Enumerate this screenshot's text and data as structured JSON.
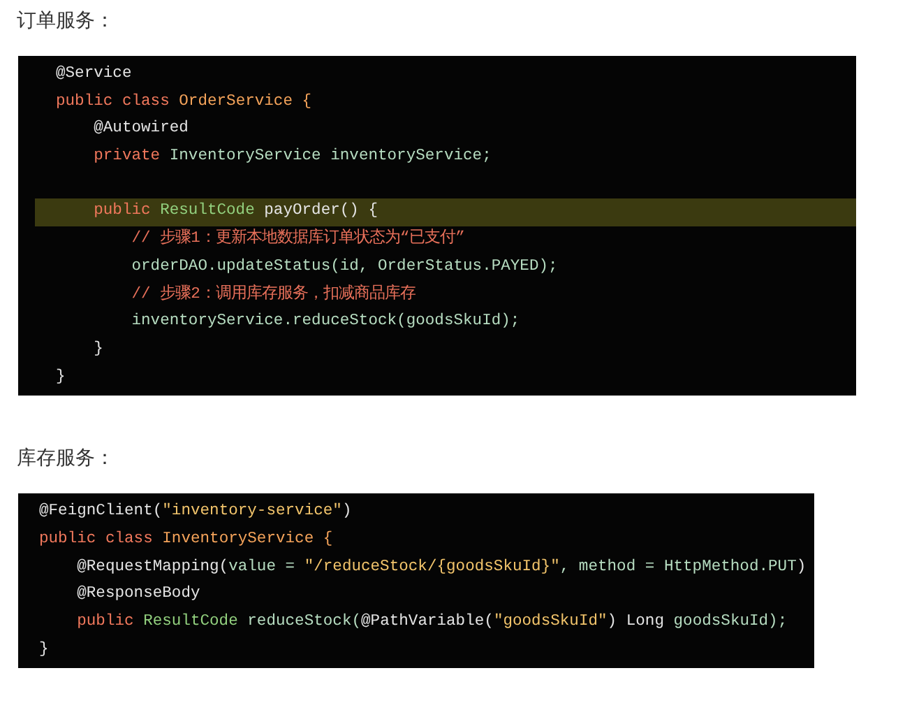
{
  "sections": [
    {
      "heading": "订单服务：",
      "code": {
        "lines": [
          {
            "highlighted": false,
            "tokens": [
              {
                "kind": "ann",
                "text": "@Service"
              }
            ]
          },
          {
            "highlighted": false,
            "tokens": [
              {
                "kind": "kw",
                "text": "public class "
              },
              {
                "kind": "cls",
                "text": "OrderService"
              },
              {
                "kind": "cls",
                "text": " {"
              }
            ]
          },
          {
            "highlighted": false,
            "tokens": [
              {
                "kind": "ann",
                "text": "    @Autowired"
              }
            ]
          },
          {
            "highlighted": false,
            "tokens": [
              {
                "kind": "kw",
                "text": "    private "
              },
              {
                "kind": "plain",
                "text": "InventoryService inventoryService;"
              }
            ]
          },
          {
            "highlighted": false
          },
          {
            "highlighted": true,
            "tokens": [
              {
                "kind": "kw",
                "text": "    public "
              },
              {
                "kind": "type",
                "text": "ResultCode"
              },
              {
                "kind": "ann",
                "text": " payOrder() {"
              }
            ]
          },
          {
            "highlighted": false,
            "tokens": [
              {
                "kind": "comment",
                "text": "        // 步骤1：更新本地数据库订单状态为“已支付”"
              }
            ]
          },
          {
            "highlighted": false,
            "tokens": [
              {
                "kind": "plain",
                "text": "        orderDAO.updateStatus(id, OrderStatus.PAYED);"
              }
            ]
          },
          {
            "highlighted": false,
            "tokens": [
              {
                "kind": "comment",
                "text": "        // 步骤2：调用库存服务，扣减商品库存"
              }
            ]
          },
          {
            "highlighted": false,
            "tokens": [
              {
                "kind": "plain",
                "text": "        inventoryService.reduceStock(goodsSkuId);"
              }
            ]
          },
          {
            "highlighted": false,
            "tokens": [
              {
                "kind": "ann",
                "text": "    }"
              }
            ]
          },
          {
            "highlighted": false,
            "tokens": [
              {
                "kind": "ann",
                "text": "}"
              }
            ]
          }
        ]
      }
    },
    {
      "heading": "库存服务：",
      "code": {
        "lines": [
          {
            "highlighted": false,
            "tokens": [
              {
                "kind": "ann",
                "text": "@FeignClient("
              },
              {
                "kind": "str",
                "text": "\"inventory-service\""
              },
              {
                "kind": "ann",
                "text": ")"
              }
            ]
          },
          {
            "highlighted": false,
            "tokens": [
              {
                "kind": "kw",
                "text": "public class "
              },
              {
                "kind": "cls",
                "text": "InventoryService {"
              }
            ]
          },
          {
            "highlighted": false,
            "tokens": [
              {
                "kind": "ann",
                "text": "    @RequestMapping("
              },
              {
                "kind": "plain",
                "text": "value = "
              },
              {
                "kind": "str",
                "text": "\"/reduceStock/{goodsSkuId}\""
              },
              {
                "kind": "plain",
                "text": ", method = HttpMethod.PUT"
              },
              {
                "kind": "ann",
                "text": ")"
              }
            ]
          },
          {
            "highlighted": false,
            "tokens": [
              {
                "kind": "ann",
                "text": "    @ResponseBody"
              }
            ]
          },
          {
            "highlighted": false,
            "tokens": [
              {
                "kind": "kw",
                "text": "    public "
              },
              {
                "kind": "type",
                "text": "ResultCode"
              },
              {
                "kind": "plain",
                "text": " reduceStock("
              },
              {
                "kind": "ann",
                "text": "@PathVariable("
              },
              {
                "kind": "str",
                "text": "\"goodsSkuId\""
              },
              {
                "kind": "ann",
                "text": ") Long "
              },
              {
                "kind": "plain",
                "text": "goodsSkuId);"
              }
            ]
          },
          {
            "highlighted": false,
            "tokens": [
              {
                "kind": "ann",
                "text": "}"
              }
            ]
          }
        ]
      }
    }
  ]
}
